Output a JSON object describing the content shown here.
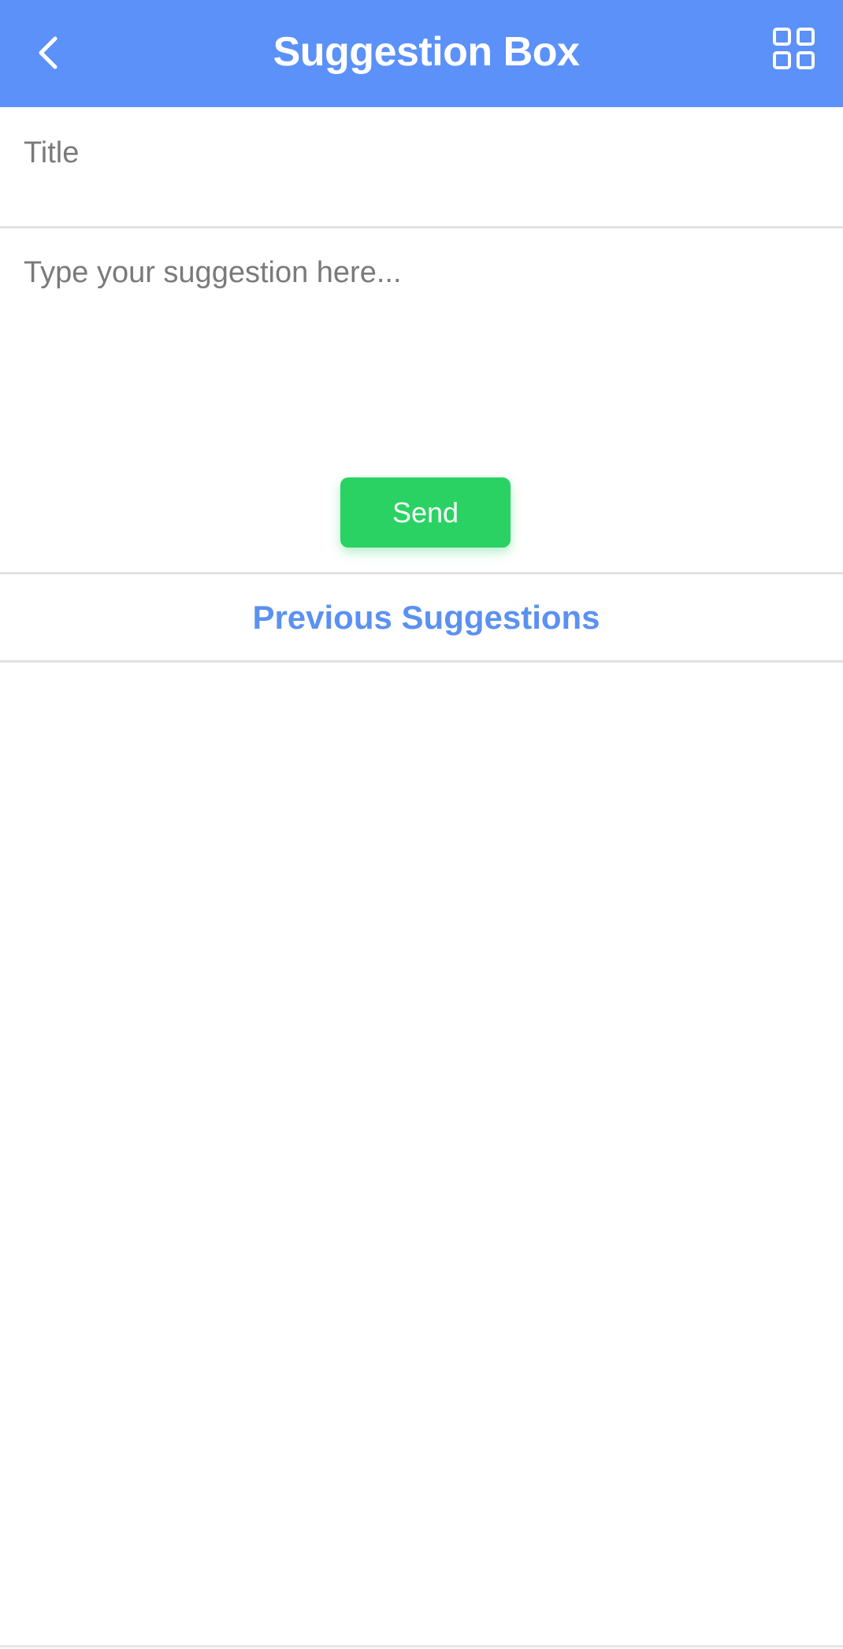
{
  "header": {
    "title": "Suggestion Box",
    "background_color": "#5b91f8",
    "back_icon": "chevron-left-icon",
    "menu_icon": "grid-icon"
  },
  "form": {
    "title_placeholder": "Title",
    "title_value": "",
    "suggestion_placeholder": "Type your suggestion here...",
    "suggestion_value": "",
    "send_label": "Send",
    "send_color": "#2ad263"
  },
  "previous": {
    "label": "Previous Suggestions",
    "color": "#5b91f0",
    "items": []
  }
}
